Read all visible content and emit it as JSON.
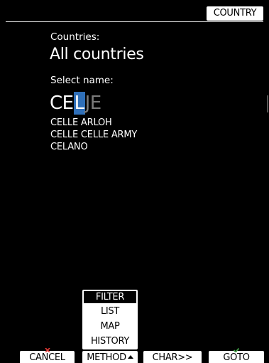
{
  "header": {
    "country_button": "COUNTRY"
  },
  "countries": {
    "label": "Countries:",
    "value": "All countries"
  },
  "select_name": {
    "label": "Select name:",
    "typed": "CE",
    "cursor_char": "L",
    "rest": "JE"
  },
  "results": [
    "CELLE ARLOH",
    "CELLE CELLE ARMY",
    "CELANO"
  ],
  "method_menu": {
    "items": [
      "FILTER",
      "LIST",
      "MAP",
      "HISTORY"
    ],
    "selected": "FILTER"
  },
  "softkeys": {
    "cancel": "CANCEL",
    "method": "METHOD",
    "char": "CHAR>>",
    "goto": "GOTO"
  },
  "colors": {
    "cursor_highlight": "#2f6fb8",
    "cancel_icon": "#e53935",
    "goto_icon": "#43a047"
  }
}
